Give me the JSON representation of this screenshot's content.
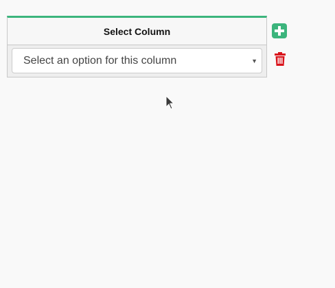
{
  "table": {
    "header_label": "Select Column",
    "select": {
      "placeholder": "Select an option for this column",
      "arrow_icon": "caret-down-icon"
    }
  },
  "actions": {
    "add_icon": "plus-square-icon",
    "delete_icon": "trash-icon"
  },
  "colors": {
    "accent": "#3cb57d",
    "danger": "#d9131b"
  }
}
